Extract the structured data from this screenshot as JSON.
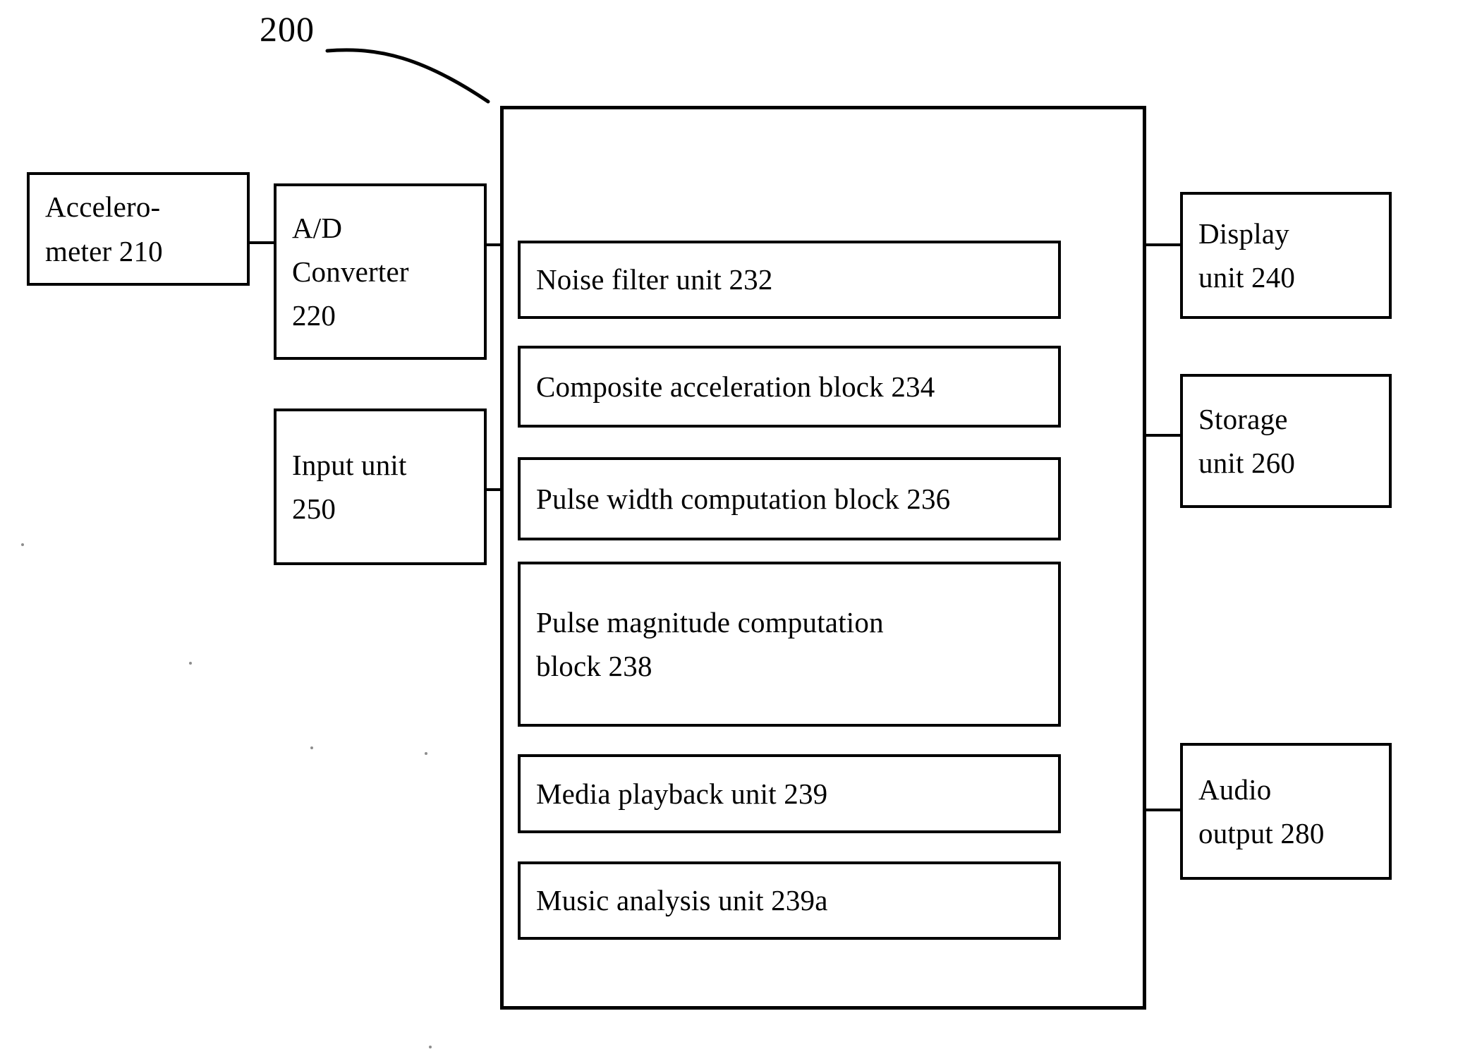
{
  "figure": {
    "reference_numeral": "200"
  },
  "left_column": [
    {
      "id": "accelerometer",
      "label": "Accelero-\nmeter 210"
    },
    {
      "id": "adc",
      "label": "A/D\nConverter\n220"
    },
    {
      "id": "input_unit",
      "label": "Input unit\n250"
    }
  ],
  "processing_unit": {
    "inner_blocks": [
      {
        "id": "noise_filter",
        "label": "Noise filter unit 232"
      },
      {
        "id": "composite_accel",
        "label": "Composite acceleration block 234"
      },
      {
        "id": "pulse_width",
        "label": "Pulse width computation block 236"
      },
      {
        "id": "pulse_magnitude",
        "label": "Pulse magnitude computation\nblock   238"
      },
      {
        "id": "media_playback",
        "label": "Media playback unit 239"
      },
      {
        "id": "music_analysis",
        "label": "Music analysis unit 239a"
      }
    ]
  },
  "right_column": [
    {
      "id": "display_unit",
      "label": "Display\nunit 240"
    },
    {
      "id": "storage_unit",
      "label": "Storage\nunit 260"
    },
    {
      "id": "audio_output",
      "label": "Audio\noutput 280"
    }
  ],
  "colors": {
    "ink": "#000000",
    "paper": "#ffffff"
  }
}
